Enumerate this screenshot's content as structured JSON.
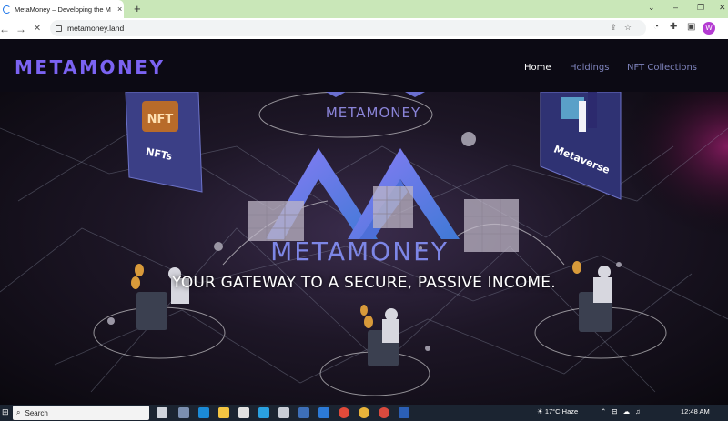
{
  "browser": {
    "tab_title": "MetaMoney – Developing the M",
    "tab_close": "×",
    "new_tab": "+",
    "url": "metamoney.land",
    "window_controls": [
      "⌄",
      "–",
      "❐",
      "✕"
    ],
    "back": "←",
    "forward": "→",
    "stop": "✕",
    "profile_initial": "W",
    "profile_color": "#b43bd2"
  },
  "site": {
    "logo": "METAMONEY",
    "nav": [
      "Home",
      "Holdings",
      "NFT Collections"
    ],
    "active_nav": "Home",
    "hero_logo_text": "METAMONEY",
    "hero_top_logo_text": "METAMONEY",
    "nft_card_text": "NFTs",
    "nft_badge": "NFT",
    "metaverse_card_text": "Metaverse",
    "hero_title": "YOUR GATEWAY TO A SECURE, PASSIVE INCOME.",
    "brand_color": "#7b63f2"
  },
  "taskbar": {
    "search_label": "Search",
    "weather": "17°C  Haze",
    "time": "12:48 AM"
  }
}
